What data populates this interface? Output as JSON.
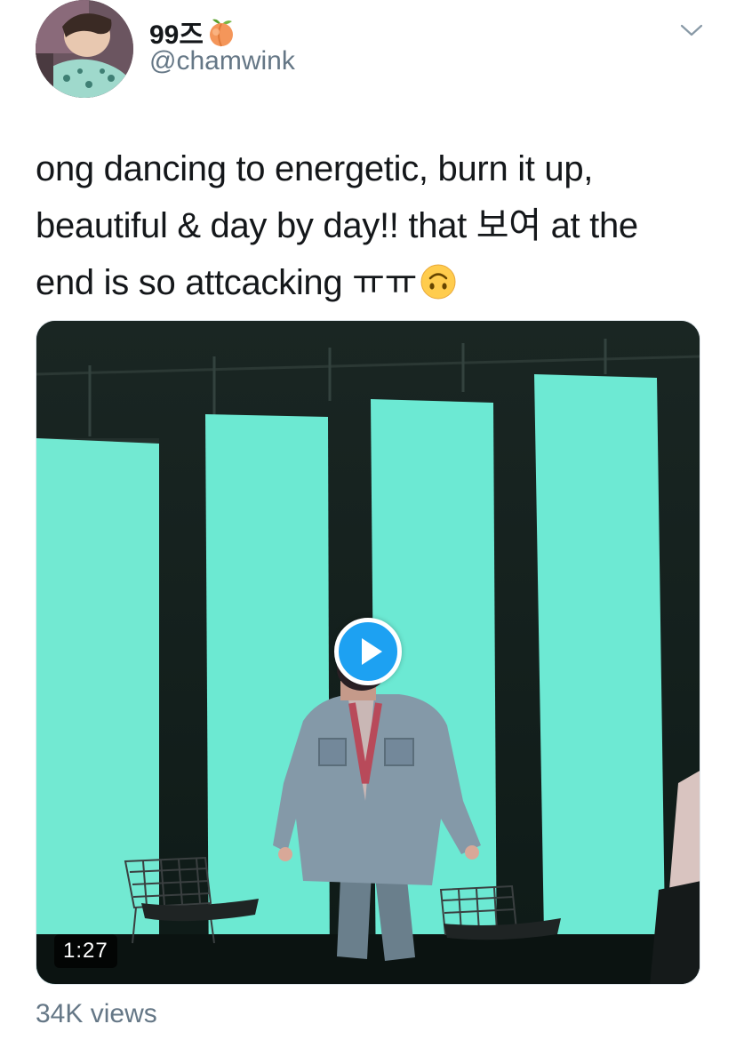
{
  "tweet": {
    "display_name": "99즈",
    "display_name_emoji": "peach-emoji",
    "handle": "@chamwink",
    "text_lines": [
      "ong dancing to energetic, burn it up,",
      "beautiful & day by day!! that 보여 at the",
      "end is so attcacking ㅠㅠ"
    ],
    "text_end_emoji": "upside-down-face-emoji",
    "menu_icon": "chevron-down-icon"
  },
  "video": {
    "duration": "1:27",
    "play_icon": "play-icon"
  },
  "stats": {
    "views": "34K views"
  },
  "colors": {
    "accent": "#1da1f2",
    "text_primary": "#14171a",
    "text_secondary": "#657786",
    "stage_panel": "#6be8d0",
    "stage_dark": "#14201d"
  }
}
